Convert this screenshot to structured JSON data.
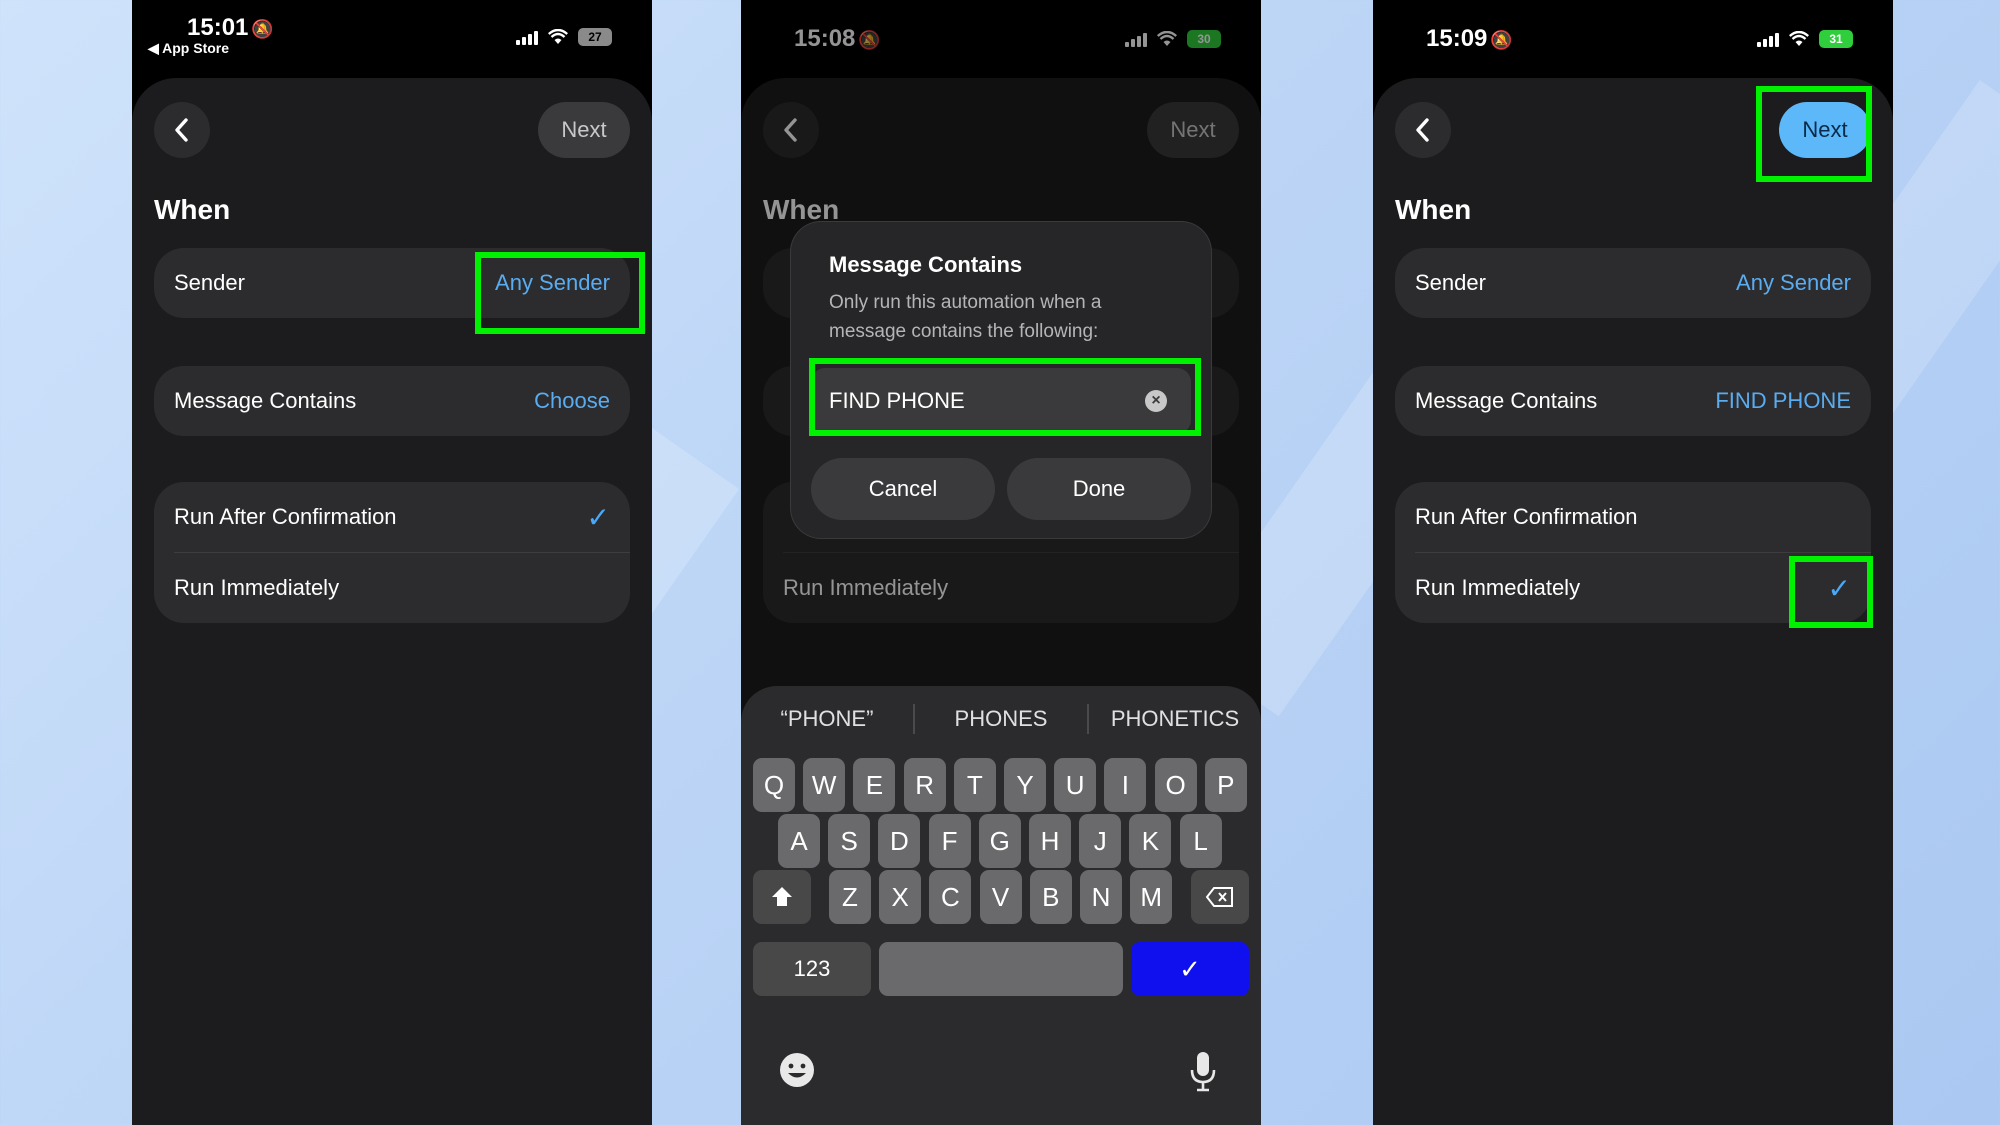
{
  "screens": [
    {
      "status": {
        "time": "15:01",
        "back_label": "◀ App Store",
        "battery": "27"
      },
      "next_label": "Next",
      "section_title": "When",
      "rows": {
        "sender": {
          "label": "Sender",
          "value": "Any Sender"
        },
        "message": {
          "label": "Message Contains",
          "value": "Choose"
        },
        "run_after": {
          "label": "Run After Confirmation",
          "check": "✓"
        },
        "run_now": {
          "label": "Run Immediately"
        }
      }
    },
    {
      "status": {
        "time": "15:08",
        "battery": "30"
      },
      "next_label": "Next",
      "section_title": "When",
      "rows": {
        "run_now": {
          "label": "Run Immediately"
        }
      },
      "dialog": {
        "title": "Message Contains",
        "message": "Only run this automation when a message contains the following:",
        "input_value": "FIND PHONE",
        "cancel_label": "Cancel",
        "done_label": "Done"
      },
      "keyboard": {
        "suggestions": [
          "“PHONE”",
          "PHONES",
          "PHONETICS"
        ],
        "row1": [
          "Q",
          "W",
          "E",
          "R",
          "T",
          "Y",
          "U",
          "I",
          "O",
          "P"
        ],
        "row2": [
          "A",
          "S",
          "D",
          "F",
          "G",
          "H",
          "J",
          "K",
          "L"
        ],
        "row3": [
          "Z",
          "X",
          "C",
          "V",
          "B",
          "N",
          "M"
        ],
        "numbers_label": "123",
        "return_symbol": "✓"
      }
    },
    {
      "status": {
        "time": "15:09",
        "battery": "31"
      },
      "next_label": "Next",
      "section_title": "When",
      "rows": {
        "sender": {
          "label": "Sender",
          "value": "Any Sender"
        },
        "message": {
          "label": "Message Contains",
          "value": "FIND PHONE"
        },
        "run_after": {
          "label": "Run After Confirmation"
        },
        "run_now": {
          "label": "Run Immediately",
          "check": "✓"
        }
      }
    }
  ],
  "colors": {
    "highlight": "#00f200",
    "accent": "#5aacf0",
    "active_button": "#5cb8f8"
  }
}
